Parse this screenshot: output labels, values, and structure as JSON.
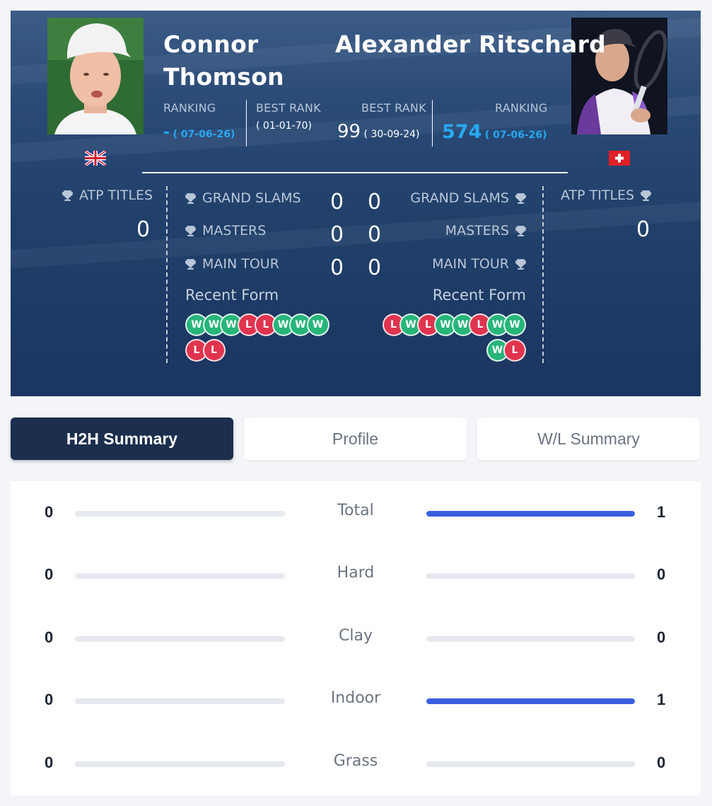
{
  "player1": {
    "name_line1": "Connor",
    "name_line2": "Thomson",
    "ranking_label": "RANKING",
    "ranking": "-",
    "ranking_date": "( 07-06-26)",
    "best_rank_label": "BEST RANK",
    "best_rank": "",
    "best_rank_date": "( 01-01-70)",
    "flag": "uk-flag-icon",
    "atp_titles_label": "ATP TITLES",
    "atp_titles": "0",
    "grand_slams": "0",
    "masters": "0",
    "main_tour": "0",
    "recent_form_label": "Recent Form",
    "form": [
      "W",
      "W",
      "W",
      "L",
      "L",
      "W",
      "W",
      "W",
      "L",
      "L"
    ]
  },
  "player2": {
    "name": "Alexander Ritschard",
    "ranking_label": "RANKING",
    "ranking": "574",
    "ranking_date": "( 07-06-26)",
    "best_rank_label": "BEST RANK",
    "best_rank": "99",
    "best_rank_date": "( 30-09-24)",
    "flag": "swiss-flag-icon",
    "atp_titles_label": "ATP TITLES",
    "atp_titles": "0",
    "grand_slams": "0",
    "masters": "0",
    "main_tour": "0",
    "recent_form_label": "Recent Form",
    "form": [
      "L",
      "W",
      "L",
      "W",
      "W",
      "L",
      "W",
      "W",
      "W",
      "L"
    ]
  },
  "stat_labels": {
    "grand_slams": "GRAND SLAMS",
    "masters": "MASTERS",
    "main_tour": "MAIN TOUR"
  },
  "tabs": [
    {
      "label": "H2H Summary",
      "active": true
    },
    {
      "label": "Profile",
      "active": false
    },
    {
      "label": "W/L Summary",
      "active": false
    }
  ],
  "h2h": [
    {
      "label": "Total",
      "left": "0",
      "right": "1",
      "left_share": 0,
      "right_share": 1
    },
    {
      "label": "Hard",
      "left": "0",
      "right": "0",
      "left_share": 0,
      "right_share": 0
    },
    {
      "label": "Clay",
      "left": "0",
      "right": "0",
      "left_share": 0,
      "right_share": 0
    },
    {
      "label": "Indoor",
      "left": "0",
      "right": "1",
      "left_share": 0,
      "right_share": 1
    },
    {
      "label": "Grass",
      "left": "0",
      "right": "0",
      "left_share": 0,
      "right_share": 0
    }
  ],
  "colors": {
    "win": "#27b57a",
    "loss": "#e0344f",
    "bar_fill": "#3a5ee0",
    "accent_blue": "#28a8f2",
    "tab_active": "#1c2e4e"
  }
}
